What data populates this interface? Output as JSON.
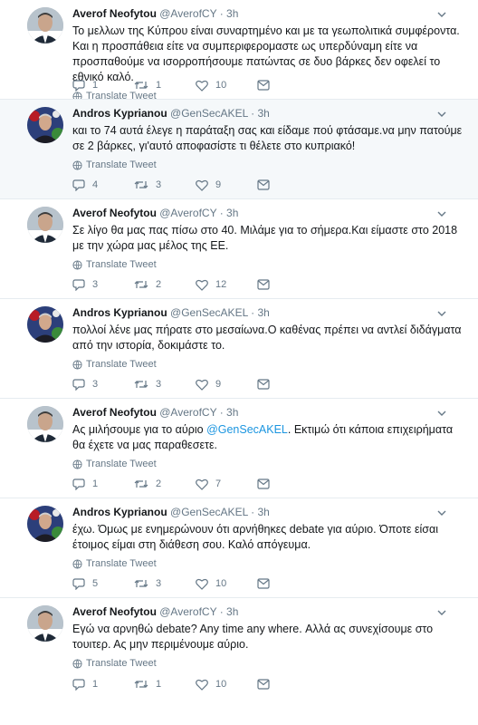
{
  "translate_label": "Translate Tweet",
  "tweets": [
    {
      "name": "Averof Neofytou",
      "handle": "@AverofCY",
      "dot": "·",
      "time": "3h",
      "avatar": "averof",
      "text_parts": [
        "Το μελλων της Κύπρου είναι συναρτημένο και με τα γεωπολιτικά συμφέροντα. Και η προσπάθεια είτε να  συμπεριφερομαστε ως υπερδύναμη είτε να προσπαθούμε να ισορροπήσουμε πατώντας σε δυο βάρκες δεν οφελεί το εθνικό καλό."
      ],
      "replies": "1",
      "retweets": "1",
      "likes": "10"
    },
    {
      "name": "Andros Kyprianou",
      "handle": "@GenSecAKEL",
      "dot": "·",
      "time": "3h",
      "avatar": "andros",
      "text_parts": [
        "και το 74 αυτά έλεγε η παράταξη σας και είδαμε πού φτάσαμε.να μην πατούμε σε 2 βάρκες, γι'αυτό αποφασίστε τι θέλετε στο κυπριακό!"
      ],
      "replies": "4",
      "retweets": "3",
      "likes": "9"
    },
    {
      "name": "Averof Neofytou",
      "handle": "@AverofCY",
      "dot": "·",
      "time": "3h",
      "avatar": "averof",
      "text_parts": [
        "Σε λίγο θα μας πας πίσω στο 40. Μιλάμε για το σήμερα.Και είμαστε στο 2018 με την χώρα μας μέλος της ΕΕ."
      ],
      "replies": "3",
      "retweets": "2",
      "likes": "12"
    },
    {
      "name": "Andros Kyprianou",
      "handle": "@GenSecAKEL",
      "dot": "·",
      "time": "3h",
      "avatar": "andros",
      "text_parts": [
        "πολλοί λένε μας πήρατε στο μεσαίωνα.Ο καθένας πρέπει να αντλεί διδάγματα από την ιστορία, δοκιμάστε το."
      ],
      "replies": "3",
      "retweets": "3",
      "likes": "9"
    },
    {
      "name": "Averof Neofytou",
      "handle": "@AverofCY",
      "dot": "·",
      "time": "3h",
      "avatar": "averof",
      "text_parts": [
        "Ας μιλήσουμε για το αύριο ",
        "@GenSecAKEL",
        ". Εκτιμώ ότι κάποια επιχειρήματα θα έχετε να μας παραθεσετε."
      ],
      "replies": "1",
      "retweets": "2",
      "likes": "7"
    },
    {
      "name": "Andros Kyprianou",
      "handle": "@GenSecAKEL",
      "dot": "·",
      "time": "3h",
      "avatar": "andros",
      "text_parts": [
        "έχω. Όμως με ενημερώνουν ότι αρνήθηκες debate για αύριο. Όποτε είσαι έτοιμος είμαι στη διάθεση σου. Καλό απόγευμα."
      ],
      "replies": "5",
      "retweets": "3",
      "likes": "10"
    },
    {
      "name": "Averof Neofytou",
      "handle": "@AverofCY",
      "dot": "·",
      "time": "3h",
      "avatar": "averof",
      "text_parts": [
        "Εγώ να αρνηθώ debate? Any time any where. Αλλά ας συνεχίσουμε στο τουιτερ. Ας μην περιμένουμε αύριο."
      ],
      "replies": "1",
      "retweets": "1",
      "likes": "10"
    }
  ]
}
